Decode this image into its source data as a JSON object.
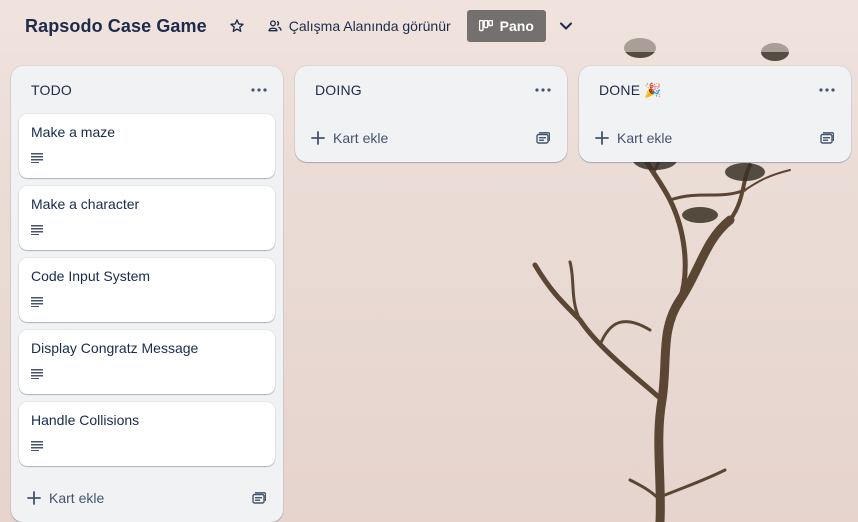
{
  "header": {
    "board_title": "Rapsodo Case Game",
    "visibility_label": "Çalışma Alanında görünür",
    "view_label": "Pano"
  },
  "lists": [
    {
      "title": "TODO",
      "cards": [
        {
          "title": "Make a maze"
        },
        {
          "title": "Make a character"
        },
        {
          "title": "Code Input System"
        },
        {
          "title": "Display Congratz Message"
        },
        {
          "title": "Handle Collisions"
        }
      ],
      "add_card_label": "Kart ekle"
    },
    {
      "title": "DOING",
      "cards": [],
      "add_card_label": "Kart ekle"
    },
    {
      "title": "DONE",
      "title_emoji": "🎉",
      "cards": [],
      "add_card_label": "Kart ekle"
    }
  ],
  "icons": {
    "star": "star-icon",
    "visibility": "people-icon",
    "board_view": "board-icon",
    "chevron": "chevron-down-icon",
    "list_menu": "more-icon",
    "description": "description-icon",
    "add": "plus-icon",
    "template": "card-template-icon"
  },
  "colors": {
    "list_bg": "#f1f2f4",
    "card_bg": "#ffffff",
    "view_button_bg": "#757070",
    "text": "#172b4d"
  }
}
